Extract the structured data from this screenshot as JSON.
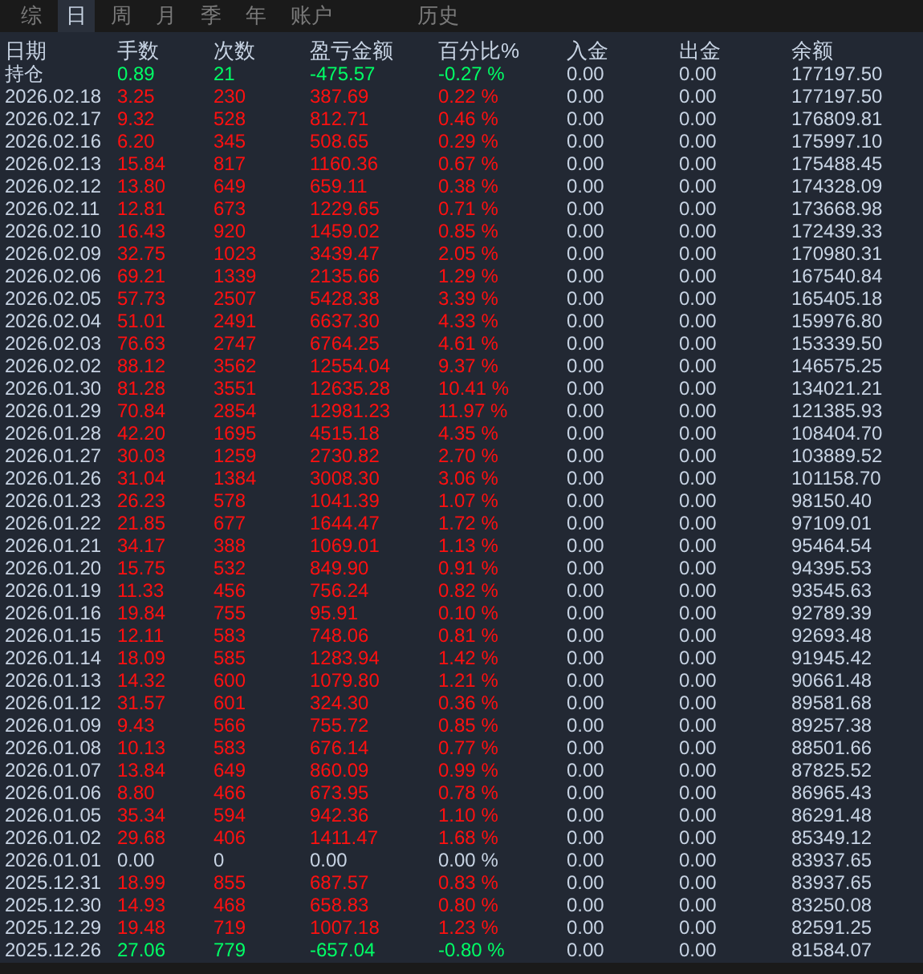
{
  "tabs": [
    {
      "label": "综",
      "selected": false
    },
    {
      "label": "日",
      "selected": true
    },
    {
      "label": "周",
      "selected": false
    },
    {
      "label": "月",
      "selected": false
    },
    {
      "label": "季",
      "selected": false
    },
    {
      "label": "年",
      "selected": false
    },
    {
      "label": "账户",
      "selected": false
    },
    {
      "label": "历史",
      "selected": false
    }
  ],
  "table": {
    "columns": [
      "日期",
      "手数",
      "次数",
      "盈亏金额",
      "百分比%",
      "入金",
      "出金",
      "余额"
    ],
    "rows": [
      {
        "color": "#00ff66",
        "cells": [
          "持仓",
          "0.89",
          "21",
          "-475.57",
          "-0.27 %",
          "0.00",
          "0.00",
          "177197.50"
        ]
      },
      {
        "color": "#ff1010",
        "cells": [
          "2026.02.18",
          "3.25",
          "230",
          "387.69",
          "0.22 %",
          "0.00",
          "0.00",
          "177197.50"
        ]
      },
      {
        "color": "#ff1010",
        "cells": [
          "2026.02.17",
          "9.32",
          "528",
          "812.71",
          "0.46 %",
          "0.00",
          "0.00",
          "176809.81"
        ]
      },
      {
        "color": "#ff1010",
        "cells": [
          "2026.02.16",
          "6.20",
          "345",
          "508.65",
          "0.29 %",
          "0.00",
          "0.00",
          "175997.10"
        ]
      },
      {
        "color": "#ff1010",
        "cells": [
          "2026.02.13",
          "15.84",
          "817",
          "1160.36",
          "0.67 %",
          "0.00",
          "0.00",
          "175488.45"
        ]
      },
      {
        "color": "#ff1010",
        "cells": [
          "2026.02.12",
          "13.80",
          "649",
          "659.11",
          "0.38 %",
          "0.00",
          "0.00",
          "174328.09"
        ]
      },
      {
        "color": "#ff1010",
        "cells": [
          "2026.02.11",
          "12.81",
          "673",
          "1229.65",
          "0.71 %",
          "0.00",
          "0.00",
          "173668.98"
        ]
      },
      {
        "color": "#ff1010",
        "cells": [
          "2026.02.10",
          "16.43",
          "920",
          "1459.02",
          "0.85 %",
          "0.00",
          "0.00",
          "172439.33"
        ]
      },
      {
        "color": "#ff1010",
        "cells": [
          "2026.02.09",
          "32.75",
          "1023",
          "3439.47",
          "2.05 %",
          "0.00",
          "0.00",
          "170980.31"
        ]
      },
      {
        "color": "#ff1010",
        "cells": [
          "2026.02.06",
          "69.21",
          "1339",
          "2135.66",
          "1.29 %",
          "0.00",
          "0.00",
          "167540.84"
        ]
      },
      {
        "color": "#ff1010",
        "cells": [
          "2026.02.05",
          "57.73",
          "2507",
          "5428.38",
          "3.39 %",
          "0.00",
          "0.00",
          "165405.18"
        ]
      },
      {
        "color": "#ff1010",
        "cells": [
          "2026.02.04",
          "51.01",
          "2491",
          "6637.30",
          "4.33 %",
          "0.00",
          "0.00",
          "159976.80"
        ]
      },
      {
        "color": "#ff1010",
        "cells": [
          "2026.02.03",
          "76.63",
          "2747",
          "6764.25",
          "4.61 %",
          "0.00",
          "0.00",
          "153339.50"
        ]
      },
      {
        "color": "#ff1010",
        "cells": [
          "2026.02.02",
          "88.12",
          "3562",
          "12554.04",
          "9.37 %",
          "0.00",
          "0.00",
          "146575.25"
        ]
      },
      {
        "color": "#ff1010",
        "cells": [
          "2026.01.30",
          "81.28",
          "3551",
          "12635.28",
          "10.41 %",
          "0.00",
          "0.00",
          "134021.21"
        ]
      },
      {
        "color": "#ff1010",
        "cells": [
          "2026.01.29",
          "70.84",
          "2854",
          "12981.23",
          "11.97 %",
          "0.00",
          "0.00",
          "121385.93"
        ]
      },
      {
        "color": "#ff1010",
        "cells": [
          "2026.01.28",
          "42.20",
          "1695",
          "4515.18",
          "4.35 %",
          "0.00",
          "0.00",
          "108404.70"
        ]
      },
      {
        "color": "#ff1010",
        "cells": [
          "2026.01.27",
          "30.03",
          "1259",
          "2730.82",
          "2.70 %",
          "0.00",
          "0.00",
          "103889.52"
        ]
      },
      {
        "color": "#ff1010",
        "cells": [
          "2026.01.26",
          "31.04",
          "1384",
          "3008.30",
          "3.06 %",
          "0.00",
          "0.00",
          "101158.70"
        ]
      },
      {
        "color": "#ff1010",
        "cells": [
          "2026.01.23",
          "26.23",
          "578",
          "1041.39",
          "1.07 %",
          "0.00",
          "0.00",
          "98150.40"
        ]
      },
      {
        "color": "#ff1010",
        "cells": [
          "2026.01.22",
          "21.85",
          "677",
          "1644.47",
          "1.72 %",
          "0.00",
          "0.00",
          "97109.01"
        ]
      },
      {
        "color": "#ff1010",
        "cells": [
          "2026.01.21",
          "34.17",
          "388",
          "1069.01",
          "1.13 %",
          "0.00",
          "0.00",
          "95464.54"
        ]
      },
      {
        "color": "#ff1010",
        "cells": [
          "2026.01.20",
          "15.75",
          "532",
          "849.90",
          "0.91 %",
          "0.00",
          "0.00",
          "94395.53"
        ]
      },
      {
        "color": "#ff1010",
        "cells": [
          "2026.01.19",
          "11.33",
          "456",
          "756.24",
          "0.82 %",
          "0.00",
          "0.00",
          "93545.63"
        ]
      },
      {
        "color": "#ff1010",
        "cells": [
          "2026.01.16",
          "19.84",
          "755",
          "95.91",
          "0.10 %",
          "0.00",
          "0.00",
          "92789.39"
        ]
      },
      {
        "color": "#ff1010",
        "cells": [
          "2026.01.15",
          "12.11",
          "583",
          "748.06",
          "0.81 %",
          "0.00",
          "0.00",
          "92693.48"
        ]
      },
      {
        "color": "#ff1010",
        "cells": [
          "2026.01.14",
          "18.09",
          "585",
          "1283.94",
          "1.42 %",
          "0.00",
          "0.00",
          "91945.42"
        ]
      },
      {
        "color": "#ff1010",
        "cells": [
          "2026.01.13",
          "14.32",
          "600",
          "1079.80",
          "1.21 %",
          "0.00",
          "0.00",
          "90661.48"
        ]
      },
      {
        "color": "#ff1010",
        "cells": [
          "2026.01.12",
          "31.57",
          "601",
          "324.30",
          "0.36 %",
          "0.00",
          "0.00",
          "89581.68"
        ]
      },
      {
        "color": "#ff1010",
        "cells": [
          "2026.01.09",
          "9.43",
          "566",
          "755.72",
          "0.85 %",
          "0.00",
          "0.00",
          "89257.38"
        ]
      },
      {
        "color": "#ff1010",
        "cells": [
          "2026.01.08",
          "10.13",
          "583",
          "676.14",
          "0.77 %",
          "0.00",
          "0.00",
          "88501.66"
        ]
      },
      {
        "color": "#ff1010",
        "cells": [
          "2026.01.07",
          "13.84",
          "649",
          "860.09",
          "0.99 %",
          "0.00",
          "0.00",
          "87825.52"
        ]
      },
      {
        "color": "#ff1010",
        "cells": [
          "2026.01.06",
          "8.80",
          "466",
          "673.95",
          "0.78 %",
          "0.00",
          "0.00",
          "86965.43"
        ]
      },
      {
        "color": "#ff1010",
        "cells": [
          "2026.01.05",
          "35.34",
          "594",
          "942.36",
          "1.10 %",
          "0.00",
          "0.00",
          "86291.48"
        ]
      },
      {
        "color": "#ff1010",
        "cells": [
          "2026.01.02",
          "29.68",
          "406",
          "1411.47",
          "1.68 %",
          "0.00",
          "0.00",
          "85349.12"
        ]
      },
      {
        "color": "#c8d4e4",
        "cells": [
          "2026.01.01",
          "0.00",
          "0",
          "0.00",
          "0.00 %",
          "0.00",
          "0.00",
          "83937.65"
        ]
      },
      {
        "color": "#ff1010",
        "cells": [
          "2025.12.31",
          "18.99",
          "855",
          "687.57",
          "0.83 %",
          "0.00",
          "0.00",
          "83937.65"
        ]
      },
      {
        "color": "#ff1010",
        "cells": [
          "2025.12.30",
          "14.93",
          "468",
          "658.83",
          "0.80 %",
          "0.00",
          "0.00",
          "83250.08"
        ]
      },
      {
        "color": "#ff1010",
        "cells": [
          "2025.12.29",
          "19.48",
          "719",
          "1007.18",
          "1.23 %",
          "0.00",
          "0.00",
          "82591.25"
        ]
      },
      {
        "color": "#00ff66",
        "cells": [
          "2025.12.26",
          "27.06",
          "779",
          "-657.04",
          "-0.80 %",
          "0.00",
          "0.00",
          "81584.07"
        ]
      }
    ]
  }
}
